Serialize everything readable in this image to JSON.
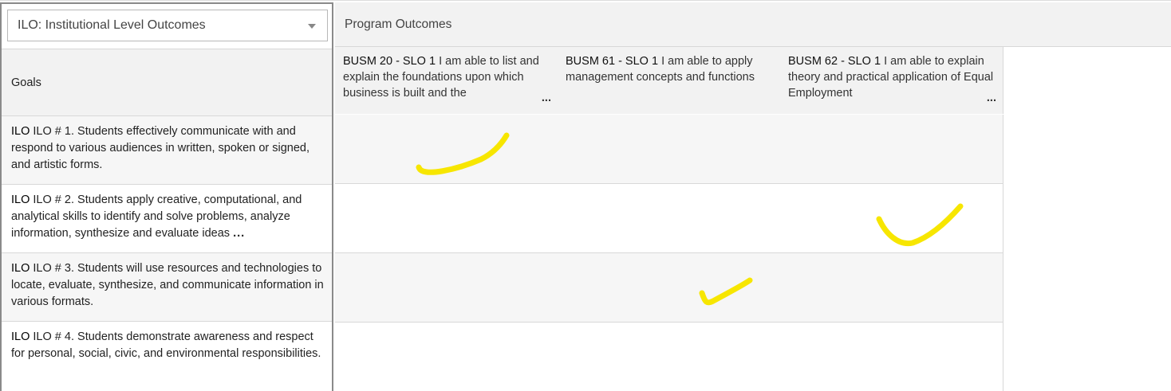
{
  "selector": {
    "value": "ILO: Institutional Level Outcomes"
  },
  "goals_header": "Goals",
  "program_outcomes_header": "Program Outcomes",
  "program_outcomes": [
    {
      "code": "BUSM 20 - SLO 1",
      "text": " I am able to list and explain the foundations upon which business is built and the",
      "truncated": "..."
    },
    {
      "code": "BUSM 61 - SLO 1",
      "text": " I am able to apply management concepts and functions",
      "truncated": ""
    },
    {
      "code": "BUSM 62 - SLO 1",
      "text": " I am able to explain theory and practical application of Equal Employment",
      "truncated": "..."
    }
  ],
  "goals": [
    {
      "tag": "ILO",
      "text": " ILO # 1. Students effectively communicate with and respond to various audiences in written, spoken or signed, and artistic forms.",
      "truncated": ""
    },
    {
      "tag": "ILO",
      "text": " ILO # 2. Students apply creative, computational, and analytical skills to identify and solve problems, analyze information, synthesize and evaluate ideas",
      "truncated": "..."
    },
    {
      "tag": "ILO",
      "text": " ILO # 3. Students will use resources and technologies to locate, evaluate, synthesize, and communicate information in various formats.",
      "truncated": ""
    },
    {
      "tag": "ILO",
      "text": " ILO # 4. Students demonstrate awareness and respect for personal, social, civic, and environmental responsibilities.",
      "truncated": ""
    }
  ],
  "mapping_marks": [
    {
      "goal": 1,
      "outcome": 1
    },
    {
      "goal": 2,
      "outcome": 3
    },
    {
      "goal": 3,
      "outcome": 2
    }
  ],
  "colors": {
    "checkmark": "#f7e600",
    "header_bg": "#f2f2f2",
    "alt_row_bg": "#f6f6f6",
    "border": "#d8d8d8"
  }
}
